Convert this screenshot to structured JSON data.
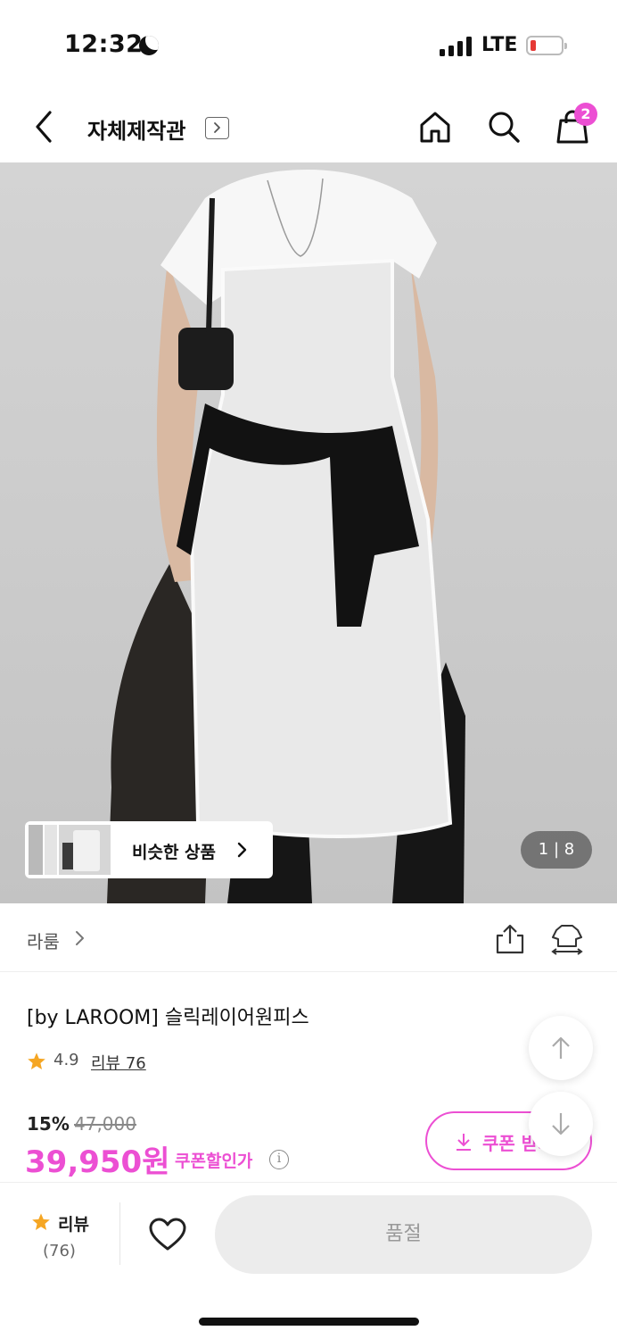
{
  "status_bar": {
    "time": "12:32",
    "network": "LTE",
    "battery_level": 0.1
  },
  "header": {
    "title": "자체제작관",
    "cart_count": "2"
  },
  "gallery": {
    "similar_label": "비슷한 상품",
    "counter": "1 | 8"
  },
  "brand": {
    "name": "라룸"
  },
  "product": {
    "name": "[by LAROOM] 슬릭레이어원피스",
    "rating": "4.9",
    "review_link": "리뷰 76",
    "discount": "15%",
    "original_price": "47,000",
    "price": "39,950원",
    "coupon_price_label": "쿠폰할인가",
    "info_symbol": "i",
    "coupon_button": "쿠폰 받기"
  },
  "bottom_bar": {
    "review_label": "리뷰",
    "review_count": "(76)",
    "soldout_label": "품절"
  },
  "colors": {
    "accent": "#ec4fd3",
    "star": "#f5a623",
    "soldout_bg": "#ececec"
  }
}
